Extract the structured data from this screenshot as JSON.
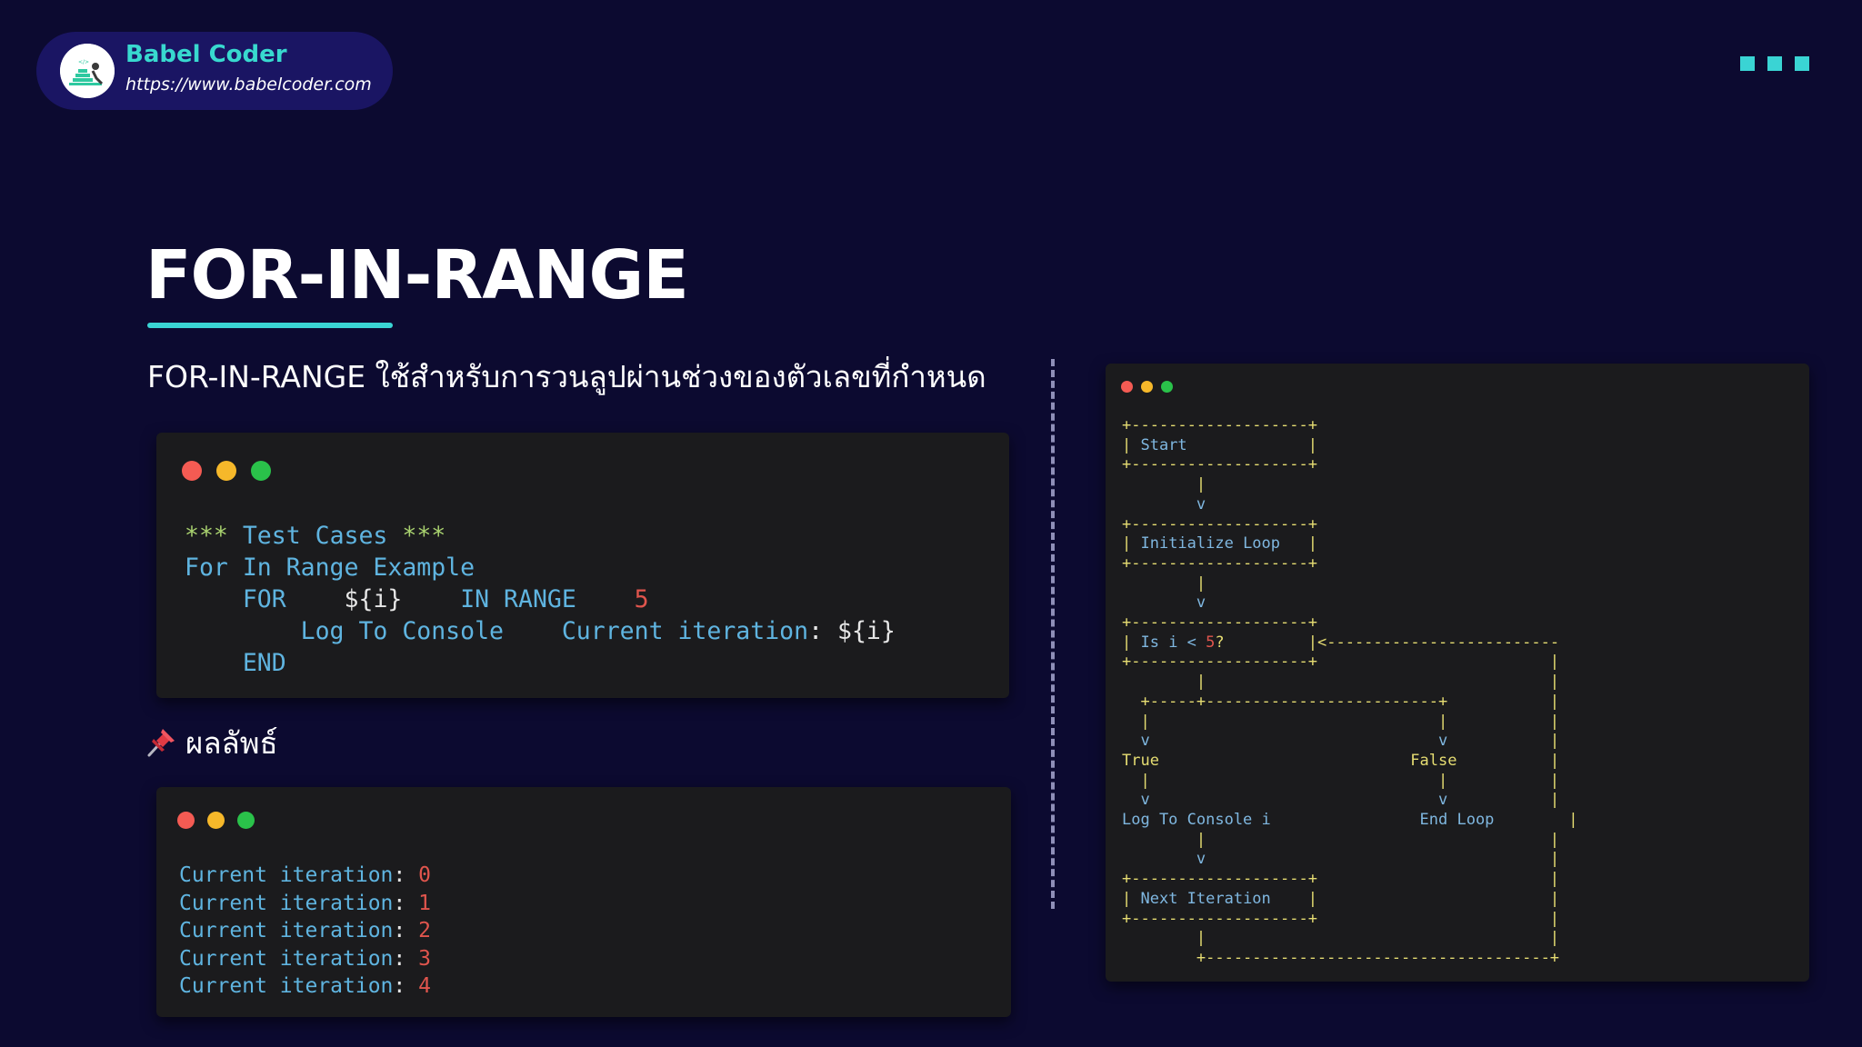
{
  "brand": {
    "name": "Babel Coder",
    "url": "https://www.babelcoder.com"
  },
  "slide": {
    "title": "FOR-IN-RANGE",
    "subtitle": "FOR-IN-RANGE ใช้สำหรับการวนลูปผ่านช่วงของตัวเลขที่กำหนด",
    "result_label": "ผลลัพธ์"
  },
  "code_sample": {
    "line1_stars_open": "***",
    "line1_text": "Test Cases",
    "line1_stars_close": "***",
    "line2": "For In Range Example",
    "for_kw": "FOR",
    "loop_var": "${i}",
    "in_range_kw": "IN RANGE",
    "range_end": "5",
    "log_kw": "Log To Console",
    "log_msg": "Current iteration",
    "log_colon": ":",
    "log_var": "${i}",
    "end_kw": "END"
  },
  "output": {
    "lines": [
      {
        "text": "Current iteration",
        "colon": ":",
        "value": "0"
      },
      {
        "text": "Current iteration",
        "colon": ":",
        "value": "1"
      },
      {
        "text": "Current iteration",
        "colon": ":",
        "value": "2"
      },
      {
        "text": "Current iteration",
        "colon": ":",
        "value": "3"
      },
      {
        "text": "Current iteration",
        "colon": ":",
        "value": "4"
      }
    ]
  },
  "flowchart": {
    "start": "Start",
    "init": "Initialize Loop",
    "cond_text": "Is i <",
    "cond_num": "5",
    "cond_q": "?",
    "true_label": "True",
    "false_label": "False",
    "log": "Log To Console i",
    "end": "End Loop",
    "next": "Next Iteration"
  },
  "colors": {
    "background": "#0c0a30",
    "accent": "#3ad4d4",
    "brand_pill": "#1a1563",
    "code_bg": "#1b1b1d",
    "dot_red": "#f45b53",
    "dot_yellow": "#f6b82a",
    "dot_green": "#2ac24a"
  },
  "icons": [
    "babel-coder-logo-icon",
    "menu-dots-icon",
    "window-close-dot-icon",
    "window-minimize-dot-icon",
    "window-maximize-dot-icon",
    "pushpin-icon"
  ]
}
